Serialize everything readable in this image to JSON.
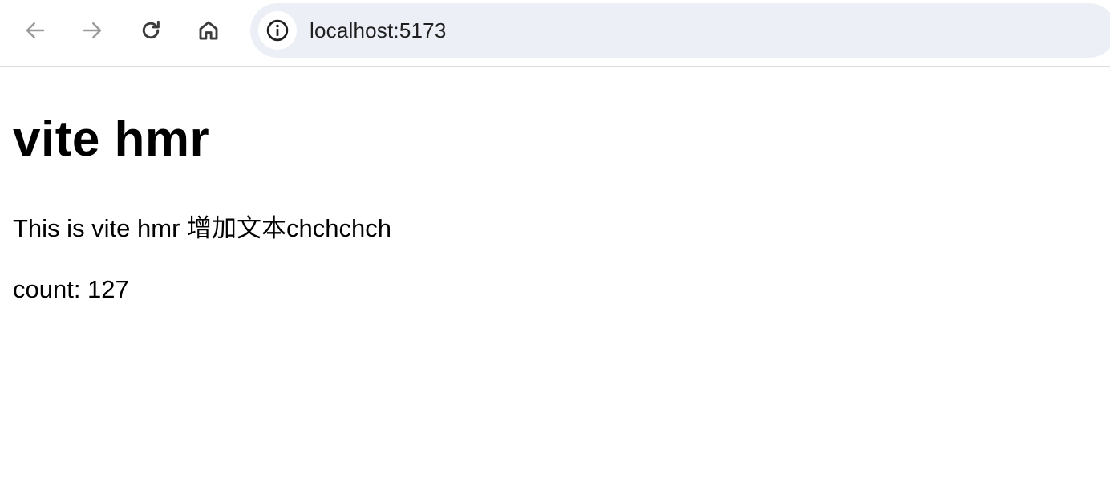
{
  "browser": {
    "back_label": "Back",
    "forward_label": "Forward",
    "reload_label": "Reload",
    "home_label": "Home",
    "url": "localhost:5173",
    "icons": {
      "back": "arrow-left-icon",
      "forward": "arrow-right-icon",
      "reload": "reload-icon",
      "home": "home-icon",
      "site_info": "info-icon"
    },
    "colors": {
      "omnibox_bg": "#eceff6",
      "disabled_icon": "#9a9a9a",
      "active_icon": "#3c3c3c"
    }
  },
  "page": {
    "title": "vite hmr",
    "description": "This is vite hmr 增加文本chchchch",
    "count_text": "count: 127"
  }
}
